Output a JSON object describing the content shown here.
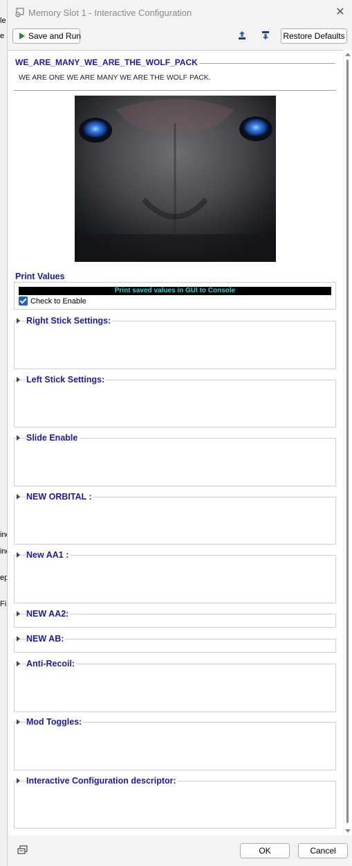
{
  "background_app": {
    "fragments": [
      "le",
      "e S",
      "inc",
      "inc",
      "ep",
      "Fi"
    ]
  },
  "window": {
    "title": "Memory Slot 1 - Interactive Configuration",
    "close_label": "✕"
  },
  "toolbar": {
    "save_label": "Save and Run",
    "restore_label": "Restore Defaults"
  },
  "header": {
    "title": "WE_ARE_MANY_WE_ARE_THE_WOLF_PACK",
    "subtitle": "WE ARE ONE WE ARE MANY WE ARE THE WOLF PACK."
  },
  "print_values": {
    "title": "Print Values",
    "banner": "Print saved values in GUI to Console",
    "checkbox_label": "Check to Enable",
    "checked": true
  },
  "sections": [
    {
      "label": "Right Stick Settings:"
    },
    {
      "label": "Left Stick Settings:"
    },
    {
      "label": "Slide Enable"
    },
    {
      "label": "NEW ORBITAL :"
    },
    {
      "label": "New AA1 :"
    },
    {
      "label": "NEW AA2:"
    },
    {
      "label": "NEW AB:"
    },
    {
      "label": "Anti-Recoil:"
    },
    {
      "label": "Mod Toggles:"
    },
    {
      "label": "Interactive Configuration descriptor:"
    }
  ],
  "footer": {
    "ok_label": "OK",
    "cancel_label": "Cancel"
  },
  "colors": {
    "section_title": "#1a1aa8",
    "banner_text": "#23d3d3",
    "checkbox": "#1e62c8",
    "save_icon": "#2a8a2a"
  },
  "icons": [
    "app-settings-icon",
    "close-icon",
    "play-icon",
    "upload-icon",
    "download-icon",
    "console-icon",
    "expand-triangle-icon",
    "check-icon"
  ]
}
